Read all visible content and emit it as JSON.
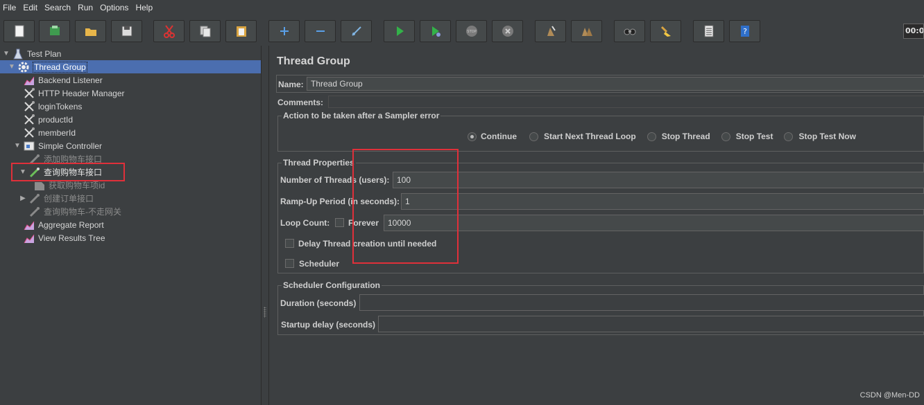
{
  "menu": [
    "File",
    "Edit",
    "Search",
    "Run",
    "Options",
    "Help"
  ],
  "toolbar": {
    "buttons": [
      "new-icon",
      "templates-icon",
      "open-icon",
      "save-icon",
      "cut-icon",
      "copy-icon",
      "paste-icon",
      "expand-icon",
      "collapse-icon",
      "toggle-icon",
      "start-icon",
      "start-no-pause-icon",
      "stop-icon",
      "shutdown-icon",
      "clear-icon",
      "clear-all-icon",
      "search-icon",
      "reset-search-icon",
      "function-helper-icon",
      "help-icon"
    ],
    "timer": "00:0"
  },
  "tree": {
    "items": [
      {
        "label": "Test Plan"
      },
      {
        "label": "Thread Group"
      },
      {
        "label": "Backend Listener"
      },
      {
        "label": "HTTP Header Manager"
      },
      {
        "label": "loginTokens"
      },
      {
        "label": "productId"
      },
      {
        "label": "memberId"
      },
      {
        "label": "Simple Controller"
      },
      {
        "label": "添加购物车接口"
      },
      {
        "label": "查询购物车接口"
      },
      {
        "label": "获取购物车项id"
      },
      {
        "label": "创建订单接口"
      },
      {
        "label": "查询购物车-不走网关"
      },
      {
        "label": "Aggregate Report"
      },
      {
        "label": "View Results Tree"
      }
    ]
  },
  "panel": {
    "title": "Thread Group",
    "name_label": "Name:",
    "name_value": "Thread Group",
    "comments_label": "Comments:",
    "sampler_error": {
      "legend": "Action to be taken after a Sampler error",
      "options": [
        "Continue",
        "Start Next Thread Loop",
        "Stop Thread",
        "Stop Test",
        "Stop Test Now"
      ],
      "selected": "Continue"
    },
    "thread_props": {
      "legend": "Thread Properties",
      "threads_label": "Number of Threads (users):",
      "threads_value": "100",
      "rampup_label": "Ramp-Up Period (in seconds):",
      "rampup_value": "1",
      "loop_label": "Loop Count:",
      "forever_label": "Forever",
      "loop_value": "10000",
      "delay_label": "Delay Thread creation until needed",
      "scheduler_label": "Scheduler"
    },
    "scheduler_config": {
      "legend": "Scheduler Configuration",
      "duration_label": "Duration (seconds)",
      "startup_label": "Startup delay (seconds)"
    }
  },
  "watermark": "CSDN @Men-DD",
  "colors": {
    "background": "#3c3f41",
    "selection": "#4b6eaf",
    "highlight": "#e0303a"
  }
}
